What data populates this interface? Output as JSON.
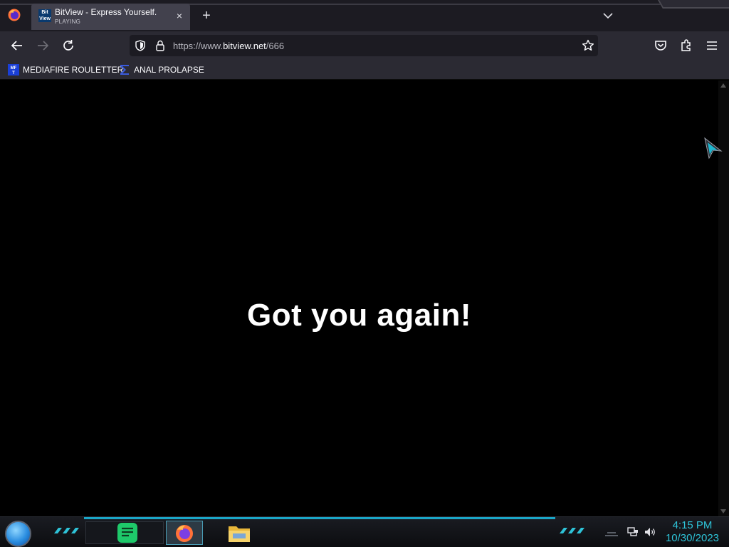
{
  "browser": {
    "tab": {
      "favicon_text": [
        "Bit",
        "View"
      ],
      "title": "BitView - Express Yourself.",
      "status": "PLAYING",
      "close_glyph": "×"
    },
    "new_tab_glyph": "+",
    "url": {
      "scheme_prefix": "https://www.",
      "host": "bitview.net",
      "path": "/666"
    },
    "bookmarks": [
      {
        "label": "MEDIAFIRE ROULETTER",
        "icon": "mediafire-icon",
        "icon_text": "MF T"
      },
      {
        "label": "ANAL PROLAPSE",
        "icon": "sigma-icon"
      }
    ],
    "accent_color": "#1c1b22"
  },
  "page": {
    "headline": "Got you again!",
    "background": "#000000",
    "text_color": "#ffffff"
  },
  "taskbar": {
    "accent_color": "#2ec3d8",
    "apps": [
      {
        "name": "notes-app",
        "icon": "notes-icon"
      },
      {
        "name": "firefox",
        "icon": "firefox-icon",
        "active": true
      },
      {
        "name": "file-explorer",
        "icon": "folder-icon"
      }
    ],
    "tray": [
      "network-icon",
      "volume-icon"
    ],
    "clock": {
      "time": "4:15 PM",
      "date": "10/30/2023"
    }
  }
}
